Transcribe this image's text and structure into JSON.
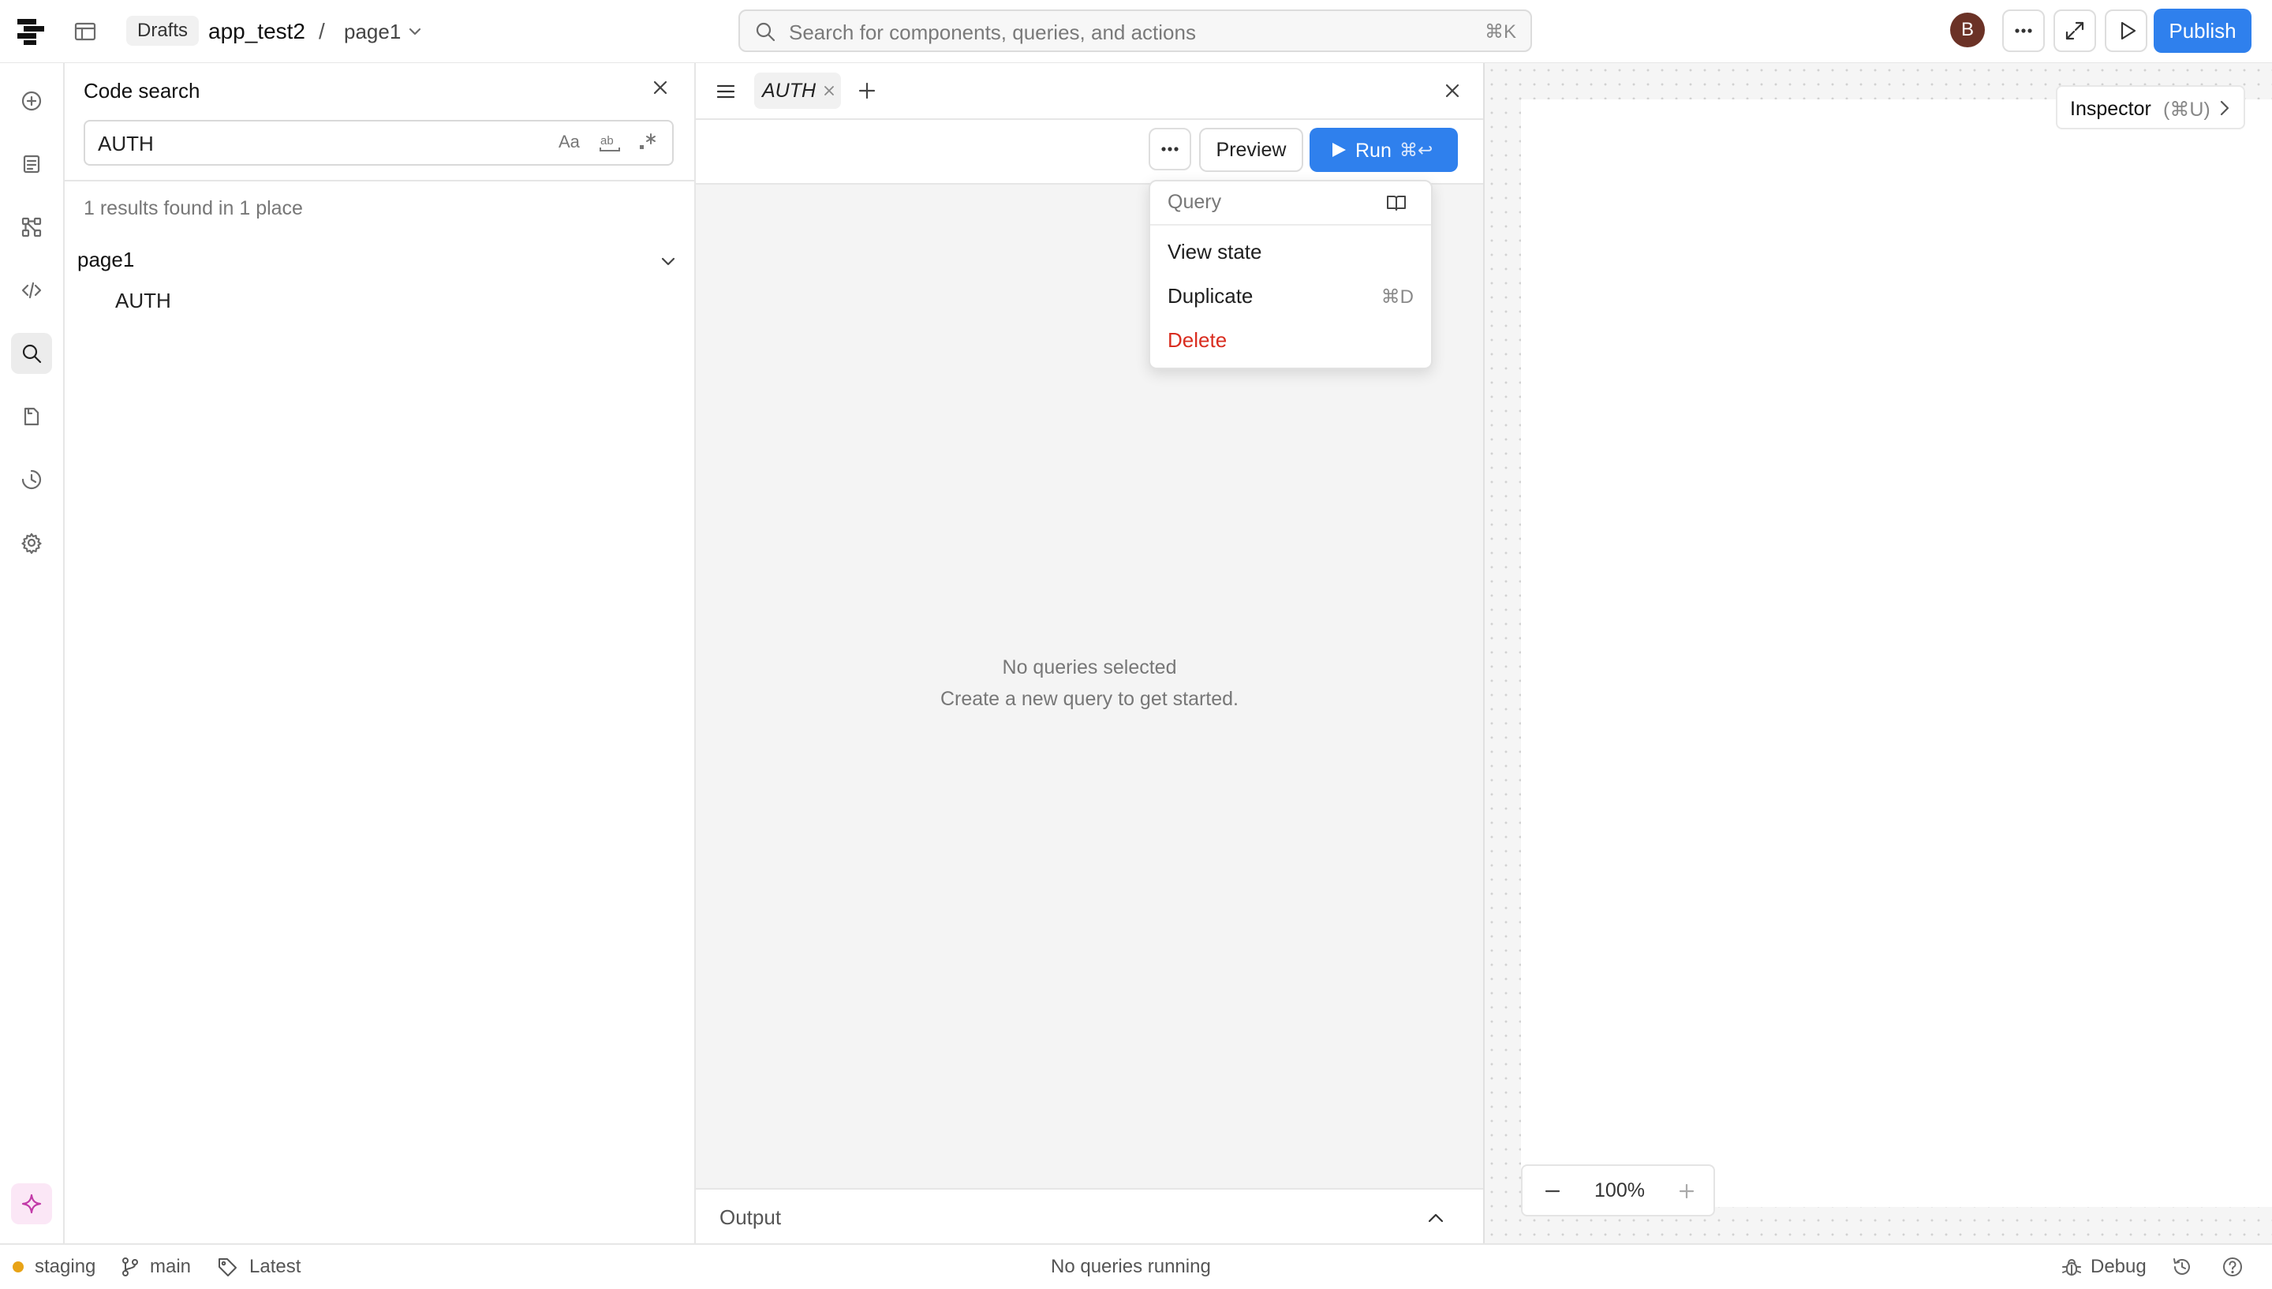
{
  "topbar": {
    "drafts_label": "Drafts",
    "app_name": "app_test2",
    "separator": "/",
    "page_name": "page1",
    "search_placeholder": "Search for components, queries, and actions",
    "search_shortcut": "⌘K",
    "avatar_initial": "B",
    "publish_label": "Publish"
  },
  "rail": {
    "items": [
      "add-icon",
      "pages-icon",
      "tree-icon",
      "code-icon",
      "search-icon",
      "files-icon",
      "history-icon",
      "settings-icon"
    ],
    "active": "search-icon",
    "ai_icon": "sparkle-icon"
  },
  "code_search": {
    "title": "Code search",
    "query": "AUTH",
    "option_icons": [
      "match-case-icon",
      "match-word-icon",
      "regex-icon"
    ],
    "results_summary": "1 results found in 1 place",
    "groups": [
      {
        "name": "page1",
        "matches": [
          "AUTH"
        ]
      }
    ]
  },
  "query_editor": {
    "tabs": [
      {
        "label": "AUTH"
      }
    ],
    "preview_label": "Preview",
    "run_label": "Run",
    "run_shortcut": "⌘↩",
    "empty_title": "No queries selected",
    "empty_subtitle": "Create a new query to get started.",
    "output_label": "Output"
  },
  "dropdown": {
    "header": "Query",
    "items": [
      {
        "label": "View state",
        "shortcut": ""
      },
      {
        "label": "Duplicate",
        "shortcut": "⌘D"
      },
      {
        "label": "Delete",
        "shortcut": ""
      }
    ],
    "danger_color": "#d92d20"
  },
  "canvas": {
    "inspector_label": "Inspector",
    "inspector_shortcut": "(⌘U)",
    "zoom": "100%"
  },
  "statusbar": {
    "environment": "staging",
    "branch": "main",
    "tag": "Latest",
    "center_status": "No queries running",
    "debug_label": "Debug"
  },
  "colors": {
    "accent": "#2f80ed",
    "avatar_bg": "#6b3226",
    "env_dot": "#e8a317"
  }
}
